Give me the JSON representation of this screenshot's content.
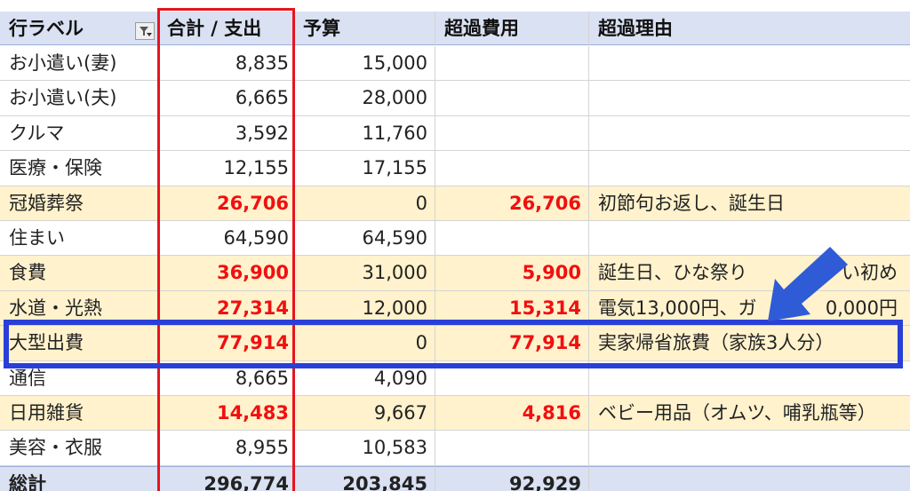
{
  "header": {
    "label": "行ラベル",
    "spend": "合計 / 支出",
    "budget": "予算",
    "excess": "超過費用",
    "reason": "超過理由"
  },
  "rows": [
    {
      "label": "お小遣い(妻)",
      "spend": "8,835",
      "budget": "15,000",
      "excess": "",
      "reason": ""
    },
    {
      "label": "お小遣い(夫)",
      "spend": "6,665",
      "budget": "28,000",
      "excess": "",
      "reason": ""
    },
    {
      "label": "クルマ",
      "spend": "3,592",
      "budget": "11,760",
      "excess": "",
      "reason": ""
    },
    {
      "label": "医療・保険",
      "spend": "12,155",
      "budget": "17,155",
      "excess": "",
      "reason": ""
    },
    {
      "label": "冠婚葬祭",
      "spend": "26,706",
      "budget": "0",
      "excess": "26,706",
      "reason": "初節句お返し、誕生日"
    },
    {
      "label": "住まい",
      "spend": "64,590",
      "budget": "64,590",
      "excess": "",
      "reason": ""
    },
    {
      "label": "食費",
      "spend": "36,900",
      "budget": "31,000",
      "excess": "5,900",
      "reason": "誕生日、ひな祭り",
      "reason_tail": "い初め"
    },
    {
      "label": "水道・光熱",
      "spend": "27,314",
      "budget": "12,000",
      "excess": "15,314",
      "reason": "電気13,000円、ガ",
      "reason_tail": "0,000円"
    },
    {
      "label": "大型出費",
      "spend": "77,914",
      "budget": "0",
      "excess": "77,914",
      "reason": "実家帰省旅費（家族3人分）"
    },
    {
      "label": "通信",
      "spend": "8,665",
      "budget": "4,090",
      "excess": "",
      "reason": ""
    },
    {
      "label": "日用雑貨",
      "spend": "14,483",
      "budget": "9,667",
      "excess": "4,816",
      "reason": "ベビー用品（オムツ、哺乳瓶等）"
    },
    {
      "label": "美容・衣服",
      "spend": "8,955",
      "budget": "10,583",
      "excess": "",
      "reason": ""
    }
  ],
  "total": {
    "label": "総計",
    "spend": "296,774",
    "budget": "203,845",
    "excess": "92,929",
    "reason": ""
  },
  "colors": {
    "header_bg": "#d9e1f2",
    "over_bg": "#fff2cc",
    "over_text": "#f01010",
    "red_frame": "#e8141e",
    "blue_frame": "#2a3fd8",
    "arrow": "#2f5bd6"
  },
  "icons": {
    "filter": "filter-dropdown-icon",
    "arrow": "arrow-down-left-icon"
  }
}
